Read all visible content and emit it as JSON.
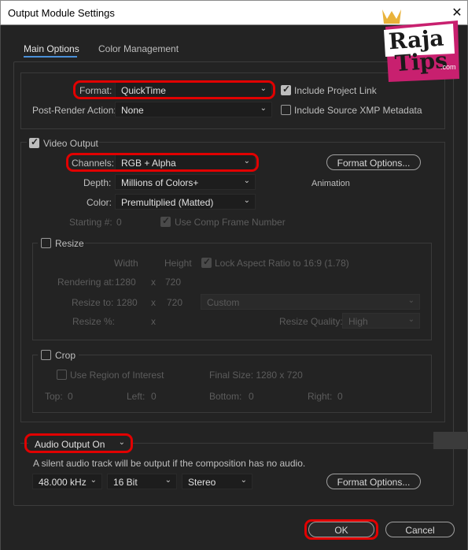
{
  "window": {
    "title": "Output Module Settings",
    "close_glyph": "✕"
  },
  "tabs": [
    {
      "label": "Main Options",
      "active": true
    },
    {
      "label": "Color Management",
      "active": false
    }
  ],
  "format": {
    "format_label": "Format:",
    "format_value": "QuickTime",
    "post_render_label": "Post-Render Action:",
    "post_render_value": "None",
    "include_project_link": {
      "label": "Include Project Link",
      "checked": true
    },
    "include_xmp": {
      "label": "Include Source XMP Metadata",
      "checked": false
    }
  },
  "video": {
    "video_output": {
      "label": "Video Output",
      "checked": true
    },
    "channels_label": "Channels:",
    "channels_value": "RGB + Alpha",
    "depth_label": "Depth:",
    "depth_value": "Millions of Colors+",
    "color_label": "Color:",
    "color_value": "Premultiplied (Matted)",
    "format_options_label": "Format Options...",
    "codec_text": "Animation",
    "starting_label": "Starting #:",
    "starting_value": "0",
    "use_comp_frame": {
      "label": "Use Comp Frame Number",
      "checked": true
    }
  },
  "resize": {
    "label": "Resize",
    "checked": false,
    "width_header": "Width",
    "height_header": "Height",
    "lock_aspect": {
      "label": "Lock Aspect Ratio to 16:9 (1.78)",
      "checked": true
    },
    "rendering_at_label": "Rendering at:",
    "rendering_w": "1280",
    "rendering_h": "720",
    "resize_to_label": "Resize to:",
    "resize_to_w": "1280",
    "resize_to_h": "720",
    "preset_value": "Custom",
    "resize_pct_label": "Resize %:",
    "x_glyph": "x",
    "resize_quality_label": "Resize Quality:",
    "resize_quality_value": "High"
  },
  "crop": {
    "label": "Crop",
    "checked": false,
    "use_roi": {
      "label": "Use Region of Interest",
      "checked": false
    },
    "final_size": "Final Size: 1280 x 720",
    "top_label": "Top:",
    "top_value": "0",
    "left_label": "Left:",
    "left_value": "0",
    "bottom_label": "Bottom:",
    "bottom_value": "0",
    "right_label": "Right:",
    "right_value": "0"
  },
  "audio": {
    "output_value": "Audio Output On",
    "note": "A silent audio track will be output if the composition has no audio.",
    "rate_value": "48.000 kHz",
    "bits_value": "16 Bit",
    "channels_value": "Stereo",
    "format_options_label": "Format Options..."
  },
  "footer": {
    "ok_label": "OK",
    "cancel_label": "Cancel"
  },
  "watermark": {
    "line1": "Raja",
    "line2": "Tips",
    "suffix": ".com"
  },
  "colors": {
    "highlight": "#e10000",
    "accent_tab": "#4a8fd8",
    "background": "#232323"
  }
}
